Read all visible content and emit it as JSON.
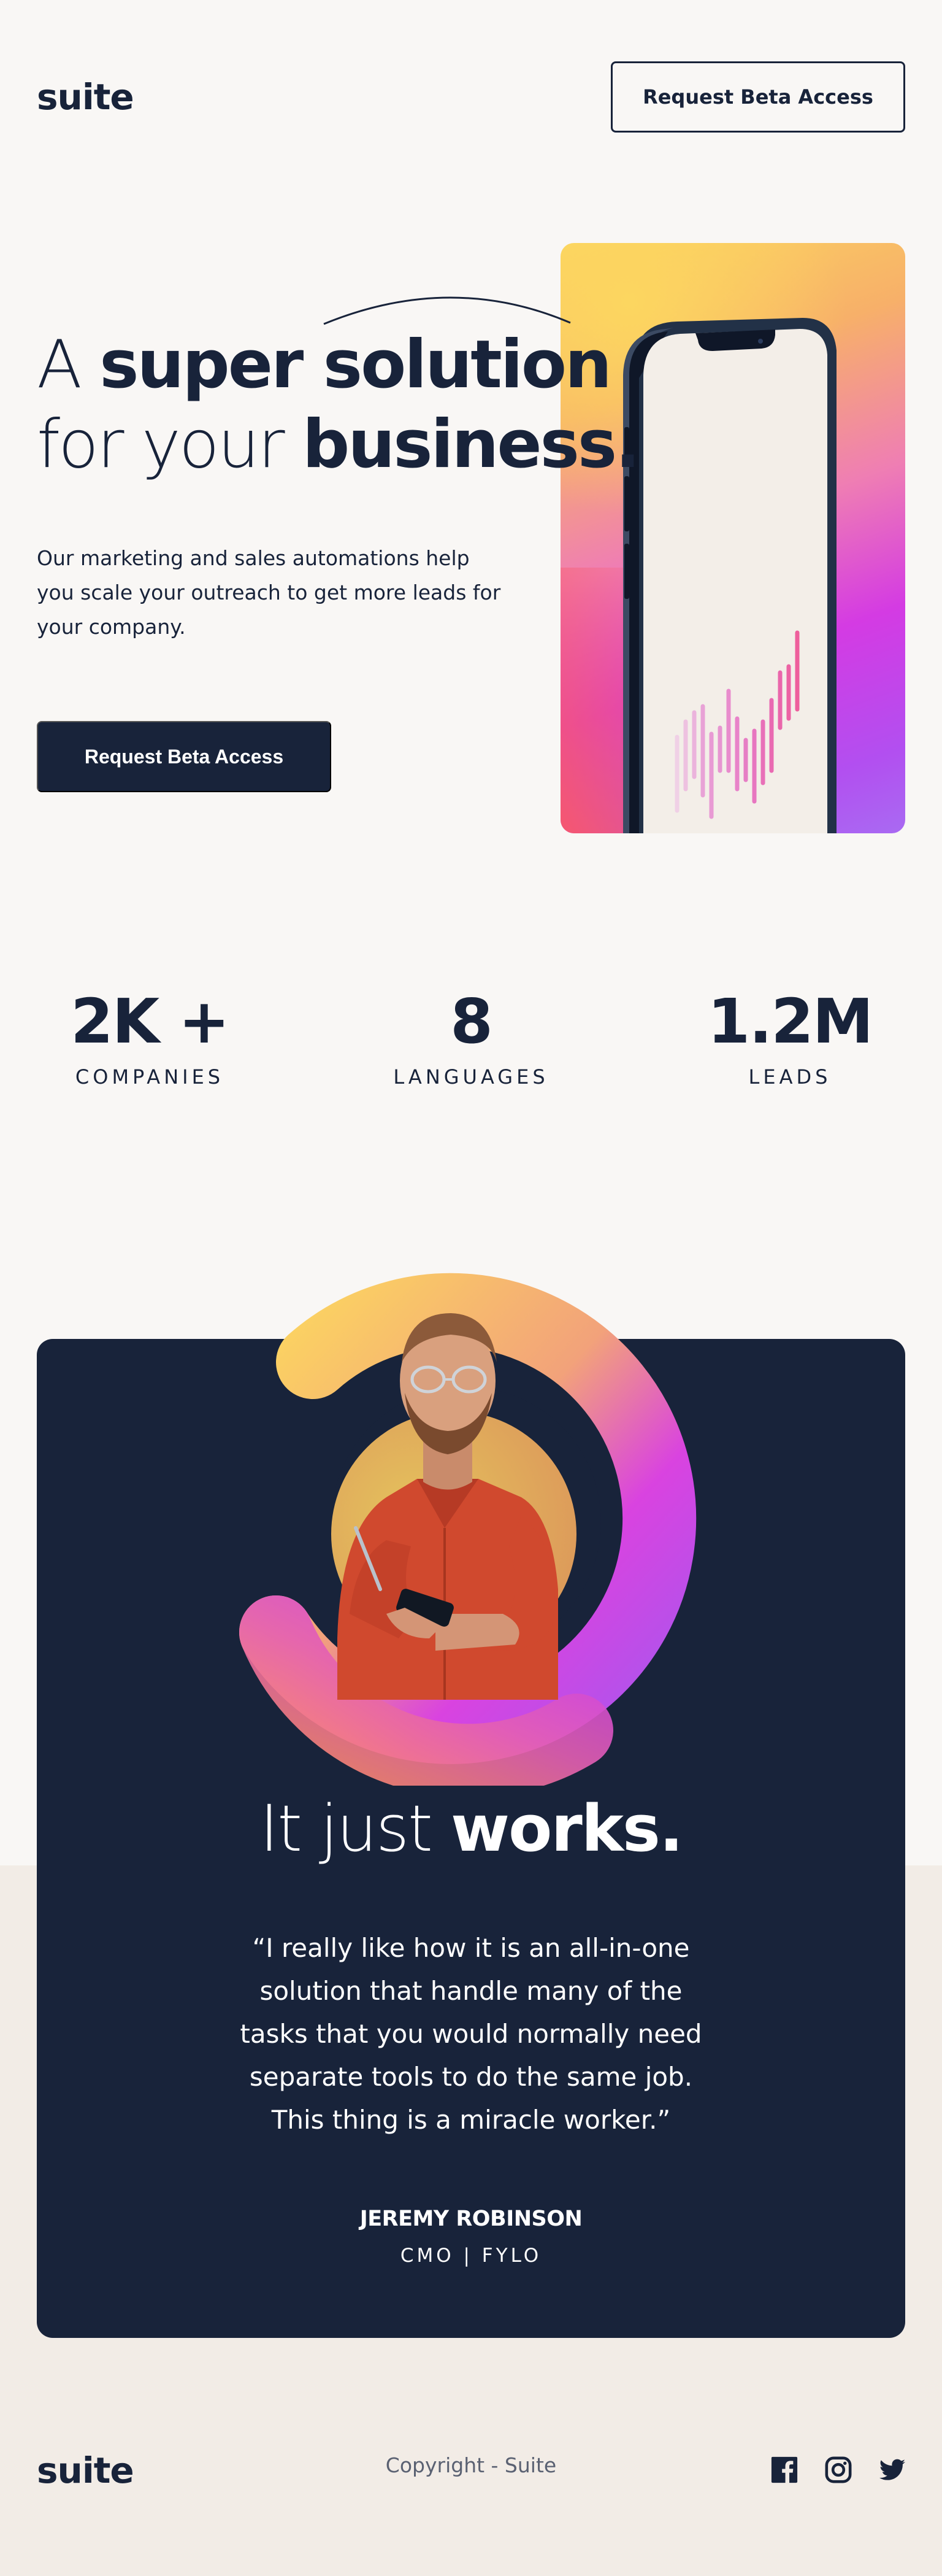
{
  "header": {
    "logo": "suite",
    "cta_label": "Request Beta Access"
  },
  "hero": {
    "title_light_1": "A ",
    "title_bold_1": "super solution",
    "title_light_2": "for your ",
    "title_bold_2": "business.",
    "description": "Our marketing and sales automations help you scale your outreach to get more leads for your company.",
    "cta_label": "Request Beta Access",
    "phone_image": "phone-with-bar-chart-illustration"
  },
  "stats": [
    {
      "value": "2K +",
      "label": "COMPANIES"
    },
    {
      "value": "8",
      "label": "LANGUAGES"
    },
    {
      "value": "1.2M",
      "label": "LEADS"
    }
  ],
  "testimonial": {
    "title_light": "It just ",
    "title_bold": "works.",
    "quote": "“I really like how it is an all-in-one solution that handle many of the tasks that you would normally need separate tools to do the same job. This thing is a miracle worker.”",
    "author_name": "JEREMY ROBINSON",
    "author_role": "CMO | FYLO",
    "photo": "man-using-phone-photo"
  },
  "footer": {
    "logo": "suite",
    "copyright": "Copyright - Suite",
    "social_icons": [
      "facebook-icon",
      "instagram-icon",
      "twitter-icon"
    ]
  },
  "colors": {
    "navy": "#18233a",
    "background": "#f9f7f5",
    "beige": "#f2ece6",
    "gradient_yellow": "#fcd660",
    "gradient_pink": "#ef7eb3",
    "gradient_purple": "#d43be3"
  }
}
